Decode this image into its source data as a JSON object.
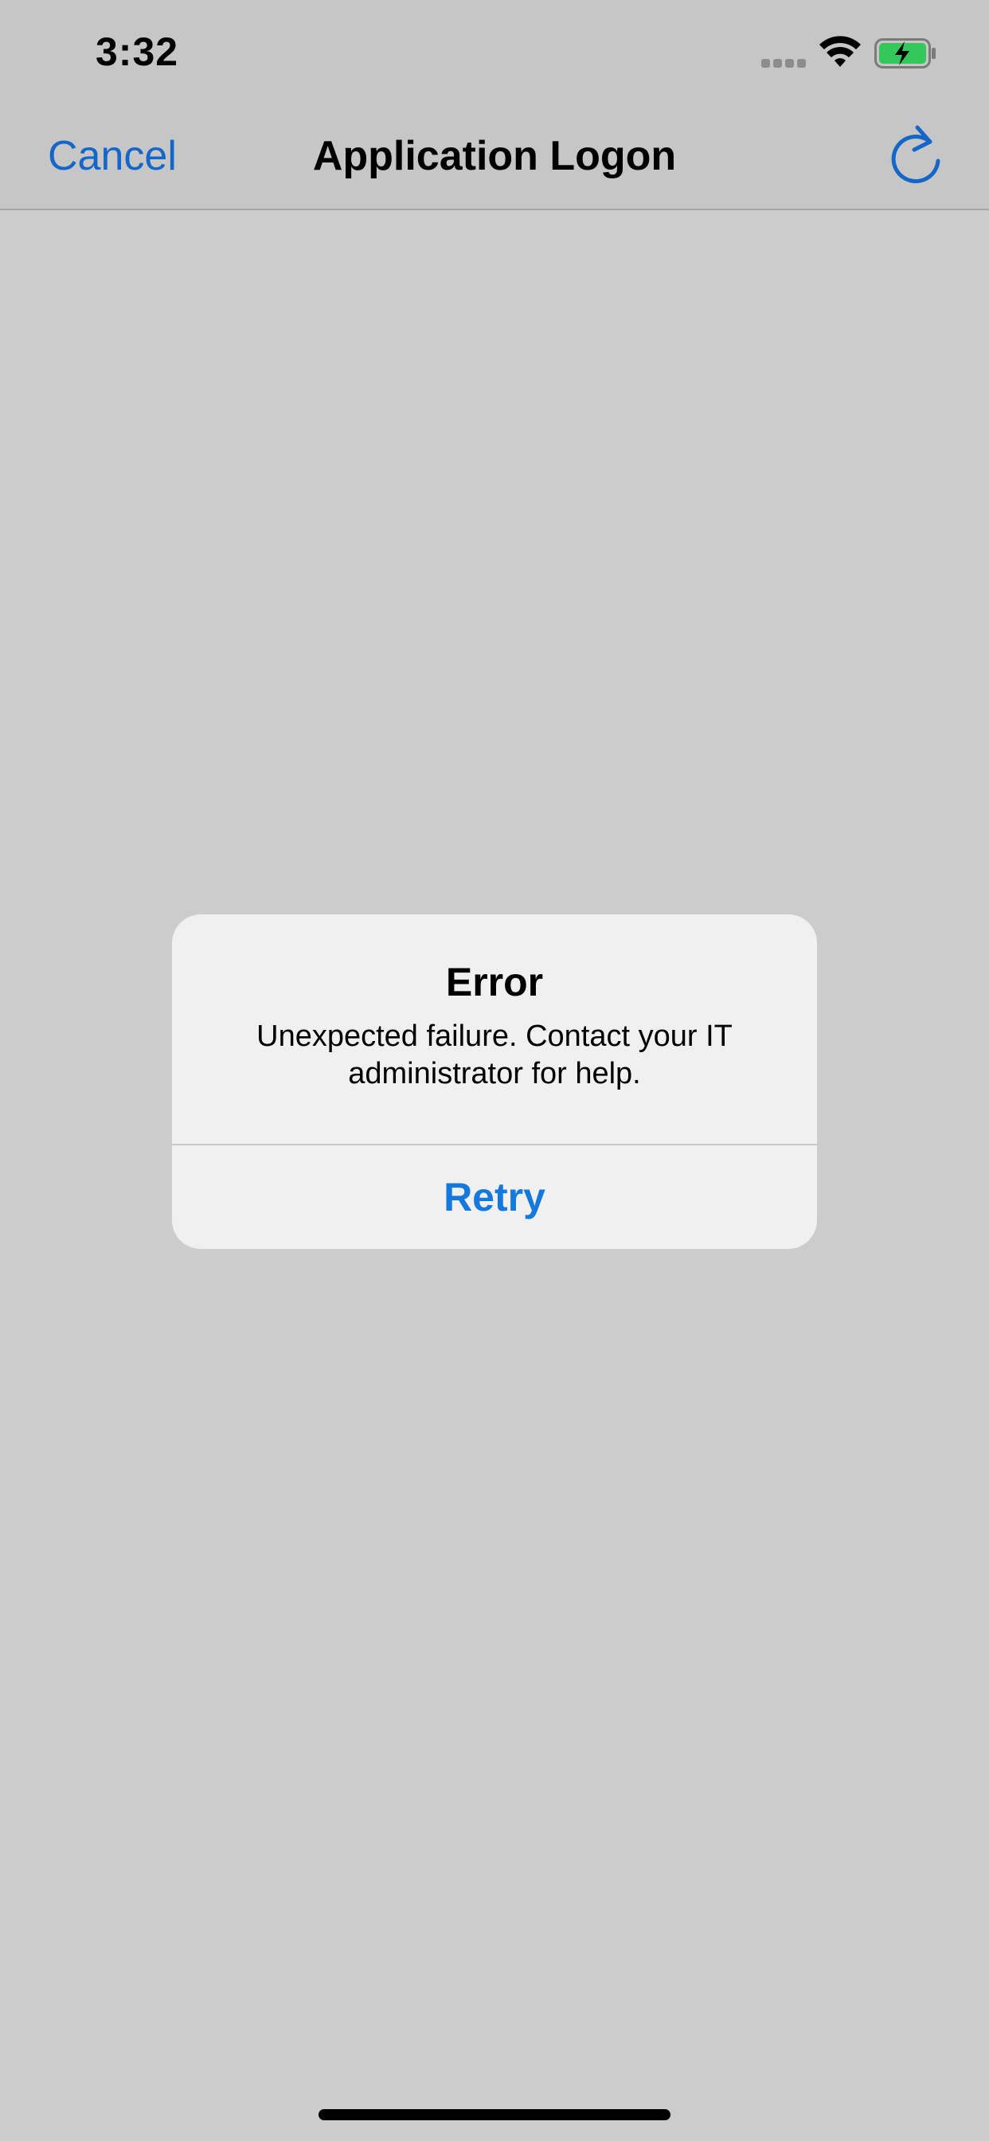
{
  "status_bar": {
    "time": "3:32",
    "signal_icon": "cellular-signal-icon",
    "wifi_icon": "wifi-icon",
    "battery_icon": "battery-charging-icon",
    "battery_color": "#34c759"
  },
  "nav": {
    "cancel_label": "Cancel",
    "title": "Application Logon",
    "refresh_icon": "refresh-icon",
    "accent_color": "#1466c8"
  },
  "alert": {
    "title": "Error",
    "message": "Unexpected failure. Contact your IT administrator for help.",
    "button_label": "Retry"
  }
}
